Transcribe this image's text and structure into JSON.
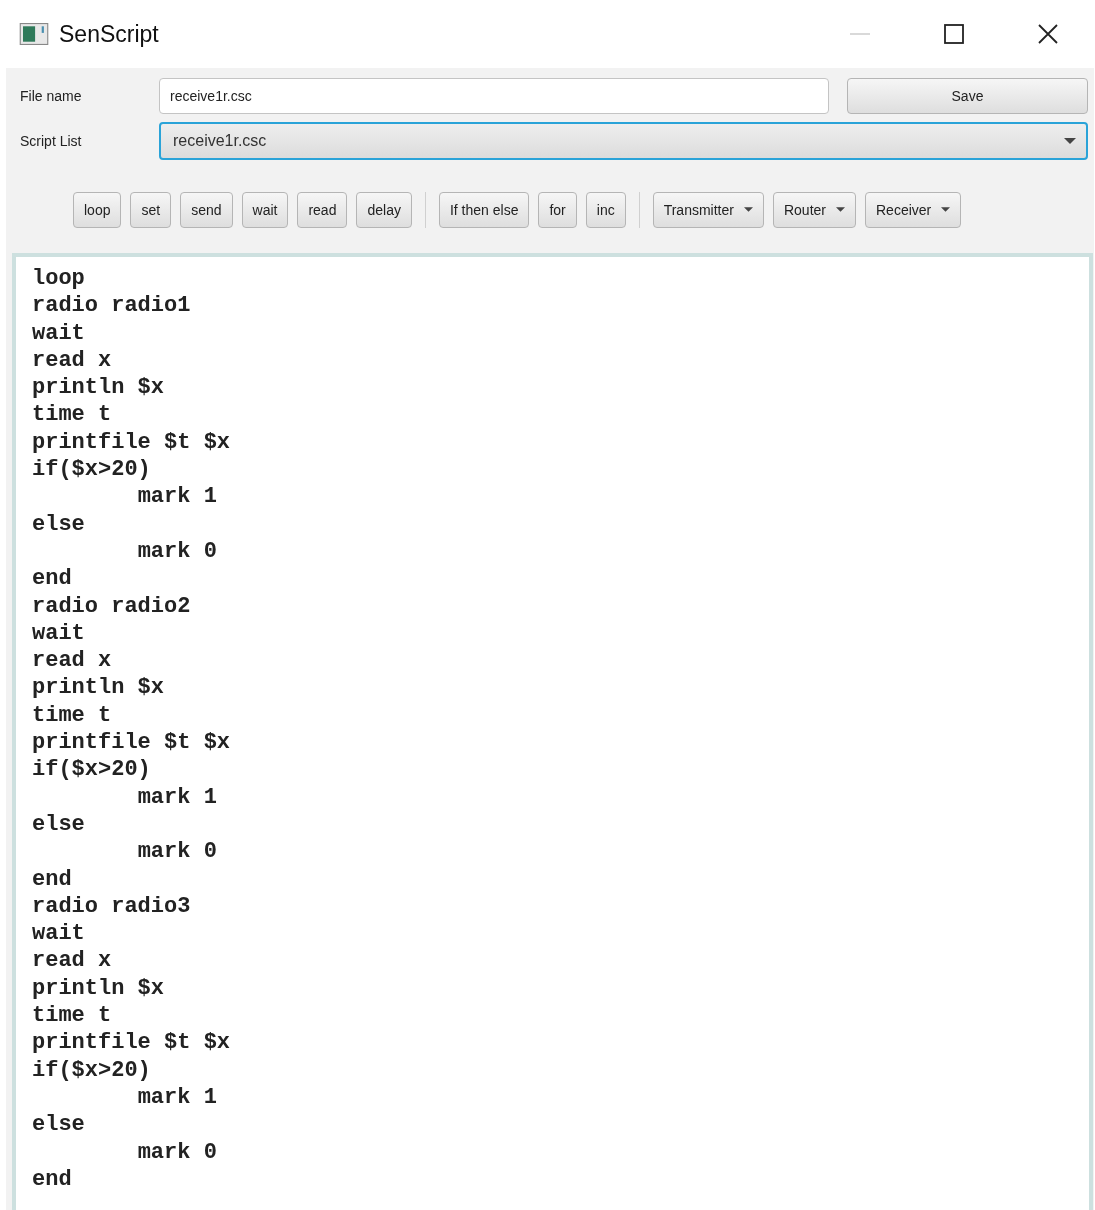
{
  "window": {
    "title": "SenScript"
  },
  "form": {
    "file_name": {
      "label": "File name",
      "value": "receive1r.csc"
    },
    "save_button": "Save",
    "script_list": {
      "label": "Script List",
      "value": "receive1r.csc",
      "focused": true
    }
  },
  "toolbar": [
    {
      "items": [
        {
          "label": "loop",
          "kind": "button"
        },
        {
          "label": "set",
          "kind": "button"
        },
        {
          "label": "send",
          "kind": "button"
        },
        {
          "label": "wait",
          "kind": "button"
        },
        {
          "label": "read",
          "kind": "button"
        },
        {
          "label": "delay",
          "kind": "button"
        }
      ]
    },
    {
      "items": [
        {
          "label": "If then else",
          "kind": "button"
        },
        {
          "label": "for",
          "kind": "button"
        },
        {
          "label": "inc",
          "kind": "button"
        }
      ]
    },
    {
      "items": [
        {
          "label": "Transmitter",
          "kind": "menu"
        },
        {
          "label": "Router",
          "kind": "menu"
        },
        {
          "label": "Receiver",
          "kind": "menu"
        }
      ]
    }
  ],
  "editor": {
    "lines": [
      "loop",
      "radio radio1",
      "wait",
      "read x",
      "println $x",
      "time t",
      "printfile $t $x",
      "if($x>20)",
      "\tmark 1",
      "else",
      "\tmark 0",
      "end",
      "radio radio2",
      "wait",
      "read x",
      "println $x",
      "time t",
      "printfile $t $x",
      "if($x>20)",
      "\tmark 1",
      "else",
      "\tmark 0",
      "end",
      "radio radio3",
      "wait",
      "read x",
      "println $x",
      "time t",
      "printfile $t $x",
      "if($x>20)",
      "\tmark 1",
      "else",
      "\tmark 0",
      "end"
    ]
  }
}
